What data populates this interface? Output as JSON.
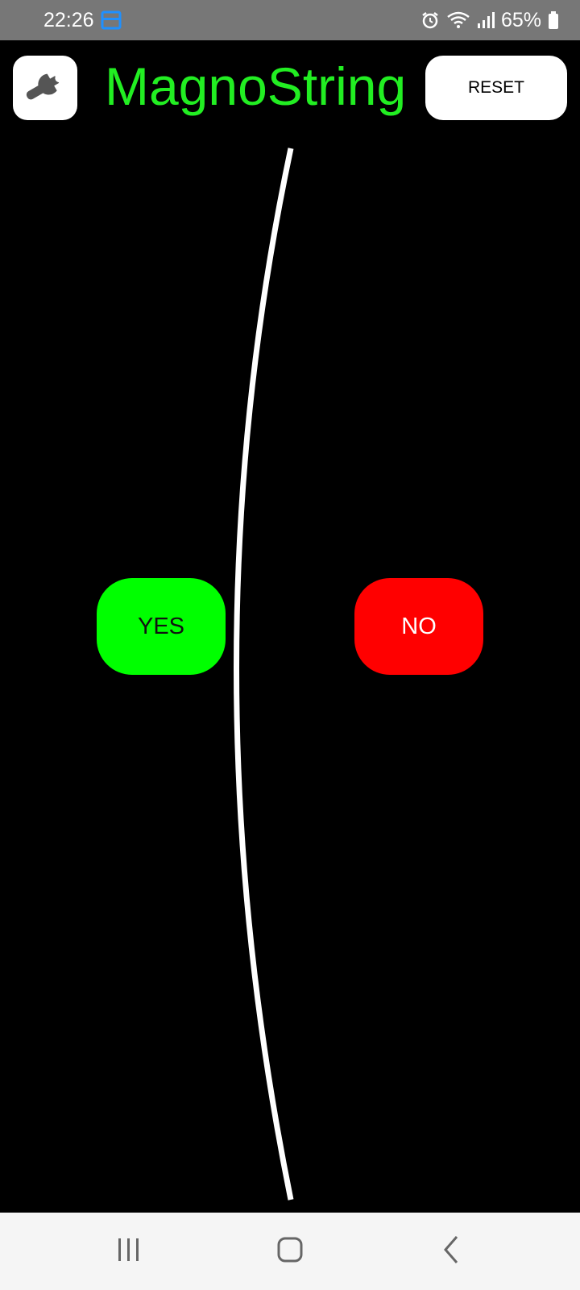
{
  "status_bar": {
    "time": "22:26",
    "battery": "65%",
    "icons": [
      "app-notification-icon",
      "alarm-icon",
      "wifi-icon",
      "signal-icon",
      "battery-icon"
    ]
  },
  "header": {
    "title": "MagnoString",
    "reset_label": "RESET",
    "settings_icon": "wrench-icon"
  },
  "choices": {
    "yes_label": "YES",
    "no_label": "NO"
  },
  "nav_bar": {
    "icons": [
      "recents-icon",
      "home-icon",
      "back-icon"
    ]
  },
  "colors": {
    "background": "#000000",
    "title": "#22ee22",
    "yes": "#00ff00",
    "no": "#ff0000",
    "string": "#ffffff",
    "status_bar": "#777777",
    "nav_bar": "#f5f5f5"
  }
}
